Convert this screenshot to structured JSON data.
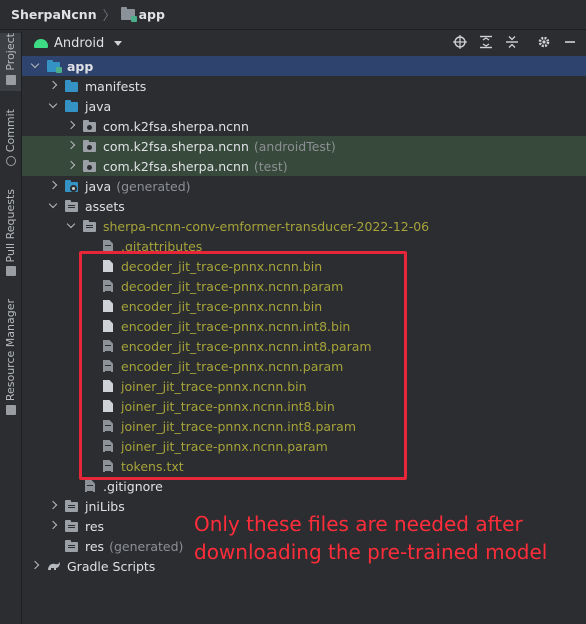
{
  "breadcrumb": {
    "project": "SherpaNcnn",
    "module": "app"
  },
  "side_strip": [
    {
      "label": "Project",
      "active": true
    },
    {
      "label": "Commit",
      "active": false
    },
    {
      "label": "Pull Requests",
      "active": false
    },
    {
      "label": "Resource Manager",
      "active": false
    }
  ],
  "toolbar": {
    "view_selector": "Android",
    "icons": [
      "locate-icon",
      "expand-all-icon",
      "collapse-all-icon",
      "settings-icon",
      "minimize-icon"
    ]
  },
  "tree": [
    {
      "label": "app",
      "suffix": "",
      "depth": 0,
      "chevron": "down",
      "icon": "module",
      "style": "bold",
      "row": "selected"
    },
    {
      "label": "manifests",
      "suffix": "",
      "depth": 1,
      "chevron": "right",
      "icon": "folder-blue",
      "style": "normal",
      "row": ""
    },
    {
      "label": "java",
      "suffix": "",
      "depth": 1,
      "chevron": "down",
      "icon": "folder-blue",
      "style": "normal",
      "row": ""
    },
    {
      "label": "com.k2fsa.sherpa.ncnn",
      "suffix": "",
      "depth": 2,
      "chevron": "right",
      "icon": "package",
      "style": "normal",
      "row": ""
    },
    {
      "label": "com.k2fsa.sherpa.ncnn",
      "suffix": "(androidTest)",
      "depth": 2,
      "chevron": "right",
      "icon": "package",
      "style": "normal",
      "row": "hl"
    },
    {
      "label": "com.k2fsa.sherpa.ncnn",
      "suffix": "(test)",
      "depth": 2,
      "chevron": "right",
      "icon": "package",
      "style": "normal",
      "row": "hl"
    },
    {
      "label": "java",
      "suffix": "(generated)",
      "depth": 1,
      "chevron": "right",
      "icon": "folder-gen",
      "style": "normal",
      "row": ""
    },
    {
      "label": "assets",
      "suffix": "",
      "depth": 1,
      "chevron": "down",
      "icon": "folder-grey",
      "style": "normal",
      "row": ""
    },
    {
      "label": "sherpa-ncnn-conv-emformer-transducer-2022-12-06",
      "suffix": "",
      "depth": 2,
      "chevron": "down",
      "icon": "folder-grey",
      "style": "asset",
      "row": ""
    },
    {
      "label": ".gitattributes",
      "suffix": "",
      "depth": 3,
      "chevron": "none",
      "icon": "doc-lines",
      "style": "asset",
      "row": ""
    },
    {
      "label": "decoder_jit_trace-pnnx.ncnn.bin",
      "suffix": "",
      "depth": 3,
      "chevron": "none",
      "icon": "doc",
      "style": "asset",
      "row": ""
    },
    {
      "label": "decoder_jit_trace-pnnx.ncnn.param",
      "suffix": "",
      "depth": 3,
      "chevron": "none",
      "icon": "doc-lines",
      "style": "asset",
      "row": ""
    },
    {
      "label": "encoder_jit_trace-pnnx.ncnn.bin",
      "suffix": "",
      "depth": 3,
      "chevron": "none",
      "icon": "doc",
      "style": "asset",
      "row": ""
    },
    {
      "label": "encoder_jit_trace-pnnx.ncnn.int8.bin",
      "suffix": "",
      "depth": 3,
      "chevron": "none",
      "icon": "doc",
      "style": "asset",
      "row": ""
    },
    {
      "label": "encoder_jit_trace-pnnx.ncnn.int8.param",
      "suffix": "",
      "depth": 3,
      "chevron": "none",
      "icon": "doc-lines",
      "style": "asset",
      "row": ""
    },
    {
      "label": "encoder_jit_trace-pnnx.ncnn.param",
      "suffix": "",
      "depth": 3,
      "chevron": "none",
      "icon": "doc-lines",
      "style": "asset",
      "row": ""
    },
    {
      "label": "joiner_jit_trace-pnnx.ncnn.bin",
      "suffix": "",
      "depth": 3,
      "chevron": "none",
      "icon": "doc",
      "style": "asset",
      "row": ""
    },
    {
      "label": "joiner_jit_trace-pnnx.ncnn.int8.bin",
      "suffix": "",
      "depth": 3,
      "chevron": "none",
      "icon": "doc",
      "style": "asset",
      "row": ""
    },
    {
      "label": "joiner_jit_trace-pnnx.ncnn.int8.param",
      "suffix": "",
      "depth": 3,
      "chevron": "none",
      "icon": "doc-lines",
      "style": "asset",
      "row": ""
    },
    {
      "label": "joiner_jit_trace-pnnx.ncnn.param",
      "suffix": "",
      "depth": 3,
      "chevron": "none",
      "icon": "doc-lines",
      "style": "asset",
      "row": ""
    },
    {
      "label": "tokens.txt",
      "suffix": "",
      "depth": 3,
      "chevron": "none",
      "icon": "doc-lines",
      "style": "asset",
      "row": ""
    },
    {
      "label": ".gitignore",
      "suffix": "",
      "depth": 2,
      "chevron": "none",
      "icon": "doc-lines",
      "style": "normal",
      "row": ""
    },
    {
      "label": "jniLibs",
      "suffix": "",
      "depth": 1,
      "chevron": "right",
      "icon": "folder-grey",
      "style": "normal",
      "row": ""
    },
    {
      "label": "res",
      "suffix": "",
      "depth": 1,
      "chevron": "right",
      "icon": "folder-grey",
      "style": "normal",
      "row": ""
    },
    {
      "label": "res",
      "suffix": "(generated)",
      "depth": 1,
      "chevron": "none",
      "icon": "folder-grey",
      "style": "normal",
      "row": ""
    },
    {
      "label": "Gradle Scripts",
      "suffix": "",
      "depth": 0,
      "chevron": "right",
      "icon": "gradle",
      "style": "normal",
      "row": ""
    }
  ],
  "annotation": {
    "line1": "Only these files are needed after",
    "line2": "downloading the pre-trained model",
    "color": "#ff2d3a"
  },
  "colors": {
    "background": "#2b2d30",
    "selection": "#2e436e",
    "asset_text": "#a6a33a",
    "package_highlight": "#36493b"
  }
}
